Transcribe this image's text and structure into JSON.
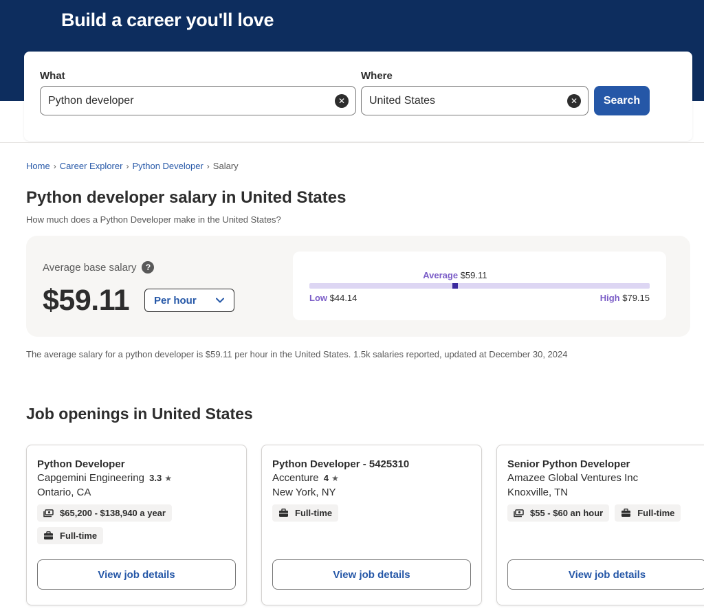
{
  "hero": {
    "title": "Build a career you'll love"
  },
  "search": {
    "what_label": "What",
    "what_value": "Python developer",
    "where_label": "Where",
    "where_value": "United States",
    "button_label": "Search"
  },
  "breadcrumb": {
    "items": [
      "Home",
      "Career Explorer",
      "Python Developer"
    ],
    "current": "Salary"
  },
  "page": {
    "title": "Python developer salary in United States",
    "subtitle": "How much does a Python Developer make in the United States?"
  },
  "salary": {
    "average_label": "Average base salary",
    "help_icon": "?",
    "average_amount": "$59.11",
    "period": "Per hour",
    "range": {
      "average_label": "Average",
      "average_value": "$59.11",
      "low_label": "Low",
      "low_value": "$44.14",
      "high_label": "High",
      "high_value": "$79.15",
      "average_position": 0.428
    },
    "summary": "The average salary for a python developer is $59.11 per hour in the United States.  1.5k salaries reported, updated at December 30, 2024"
  },
  "jobs": {
    "title": "Job openings in United States",
    "view_label": "View job details",
    "items": [
      {
        "title": "Python Developer",
        "company": "Capgemini Engineering",
        "rating": "3.3",
        "location": "Ontario, CA",
        "tags": [
          {
            "icon": "money-icon",
            "text": "$65,200 - $138,940 a year"
          },
          {
            "icon": "briefcase-icon",
            "text": "Full-time"
          }
        ]
      },
      {
        "title": "Python Developer - 5425310",
        "company": "Accenture",
        "rating": "4",
        "location": "New York, NY",
        "tags": [
          {
            "icon": "briefcase-icon",
            "text": "Full-time"
          }
        ]
      },
      {
        "title": "Senior Python Developer",
        "company": "Amazee Global Ventures Inc",
        "rating": "",
        "location": "Knoxville, TN",
        "tags": [
          {
            "icon": "money-icon",
            "text": "$55 - $60 an hour"
          },
          {
            "icon": "briefcase-icon",
            "text": "Full-time"
          }
        ]
      }
    ]
  },
  "colors": {
    "hero_bg": "#0d2d5e",
    "brand_blue": "#2557a7",
    "accent_purple": "#7a5cc7",
    "range_track": "#ddd6f3",
    "range_marker": "#3b2a9e"
  }
}
